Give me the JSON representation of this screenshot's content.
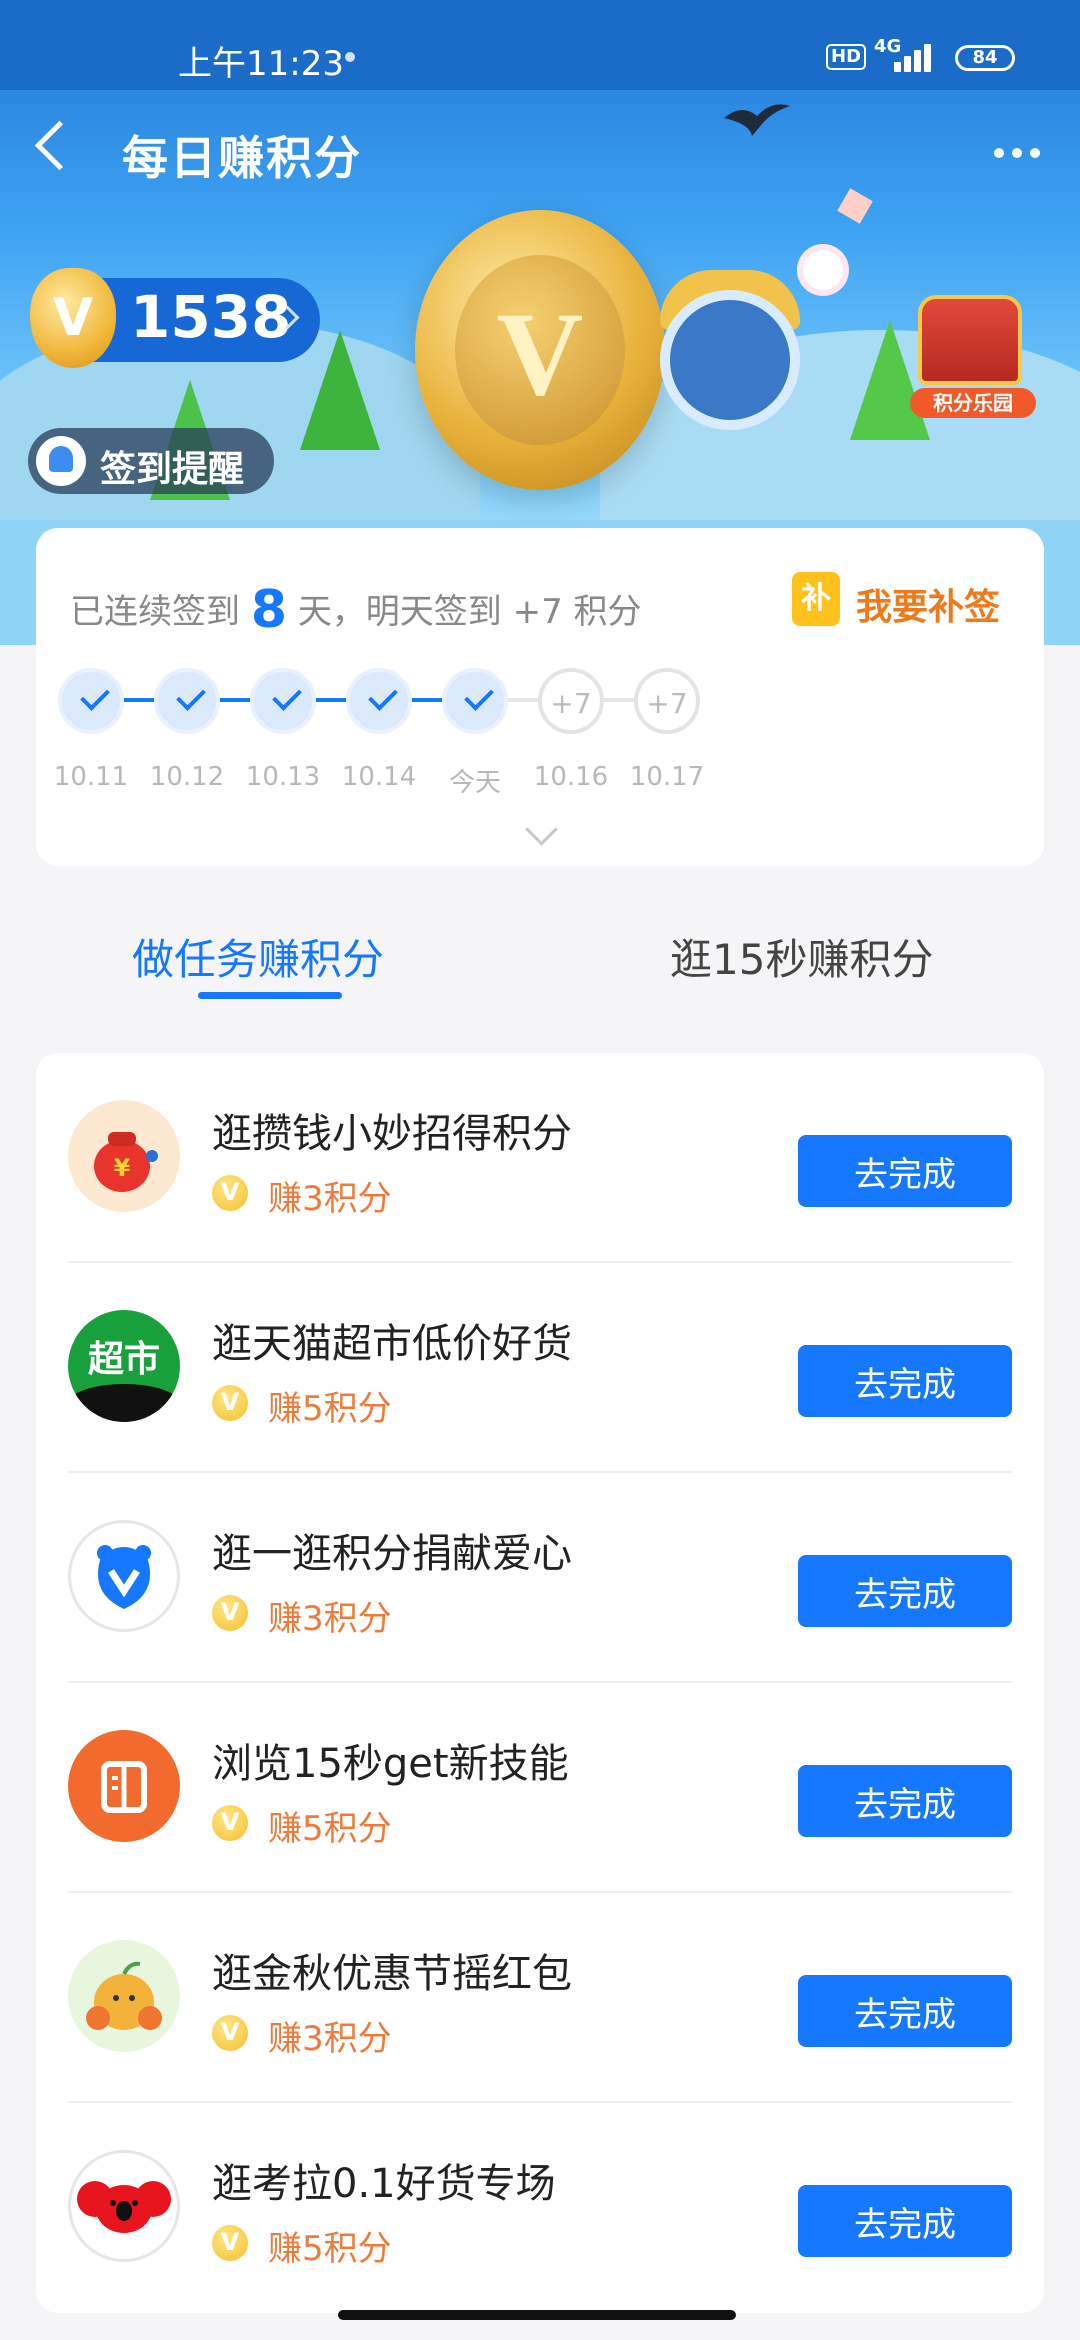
{
  "status_bar": {
    "time": "上午11:23",
    "hd": "HD",
    "network": "4G",
    "battery": "84"
  },
  "nav": {
    "title": "每日赚积分"
  },
  "banner": {
    "points_icon": "V",
    "points": "1538",
    "remind_label": "签到提醒",
    "chest_label": "积分乐园"
  },
  "signin": {
    "prefix": "已连续签到",
    "days": "8",
    "suffix": "天，明天签到 +7 积分",
    "makeup_icon": "补",
    "makeup_label": "我要补签",
    "days_list": [
      {
        "label": "10.11",
        "state": "done"
      },
      {
        "label": "10.12",
        "state": "done"
      },
      {
        "label": "10.13",
        "state": "done"
      },
      {
        "label": "10.14",
        "state": "done"
      },
      {
        "label": "今天",
        "state": "done"
      },
      {
        "label": "10.16",
        "state": "todo",
        "reward": "+7"
      },
      {
        "label": "10.17",
        "state": "todo",
        "reward": "+7"
      }
    ]
  },
  "tabs": [
    {
      "label": "做任务赚积分",
      "active": true
    },
    {
      "label": "逛15秒赚积分",
      "active": false
    }
  ],
  "tasks": [
    {
      "title": "逛攒钱小妙招得积分",
      "reward": "赚3积分",
      "button": "去完成",
      "icon": "money-bag-icon"
    },
    {
      "title": "逛天猫超市低价好货",
      "reward": "赚5积分",
      "button": "去完成",
      "icon": "tmall-supermarket-icon",
      "icon_text": "超市"
    },
    {
      "title": "逛一逛积分捐献爱心",
      "reward": "赚3积分",
      "button": "去完成",
      "icon": "charity-heart-icon"
    },
    {
      "title": "浏览15秒get新技能",
      "reward": "赚5积分",
      "button": "去完成",
      "icon": "book-icon"
    },
    {
      "title": "逛金秋优惠节摇红包",
      "reward": "赚3积分",
      "button": "去完成",
      "icon": "autumn-fruit-icon"
    },
    {
      "title": "逛考拉0.1好货专场",
      "reward": "赚5积分",
      "button": "去完成",
      "icon": "koala-icon"
    }
  ],
  "reward_coin_label": "V",
  "colors": {
    "accent": "#1677ff",
    "reward": "#f07a3a",
    "makeup": "#f07a1a"
  }
}
